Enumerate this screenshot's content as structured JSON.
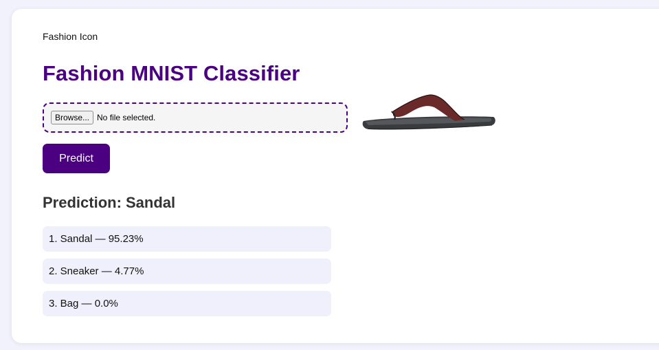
{
  "header": {
    "brand": "Fashion Icon",
    "title": "Fashion MNIST Classifier"
  },
  "upload": {
    "browse_label": "Browse...",
    "status": "No file selected."
  },
  "preview": {
    "icon": "sandal-image",
    "strap_color": "#6b2a2a",
    "sole_color": "#3a3b3f"
  },
  "actions": {
    "predict_label": "Predict"
  },
  "prediction": {
    "heading": "Prediction: Sandal",
    "results": [
      "1. Sandal — 95.23%",
      "2. Sneaker — 4.77%",
      "3. Bag — 0.0%"
    ]
  },
  "colors": {
    "accent": "#4b0082",
    "result_bg": "#f0f0fc",
    "page_bg": "#f1f2fb"
  }
}
